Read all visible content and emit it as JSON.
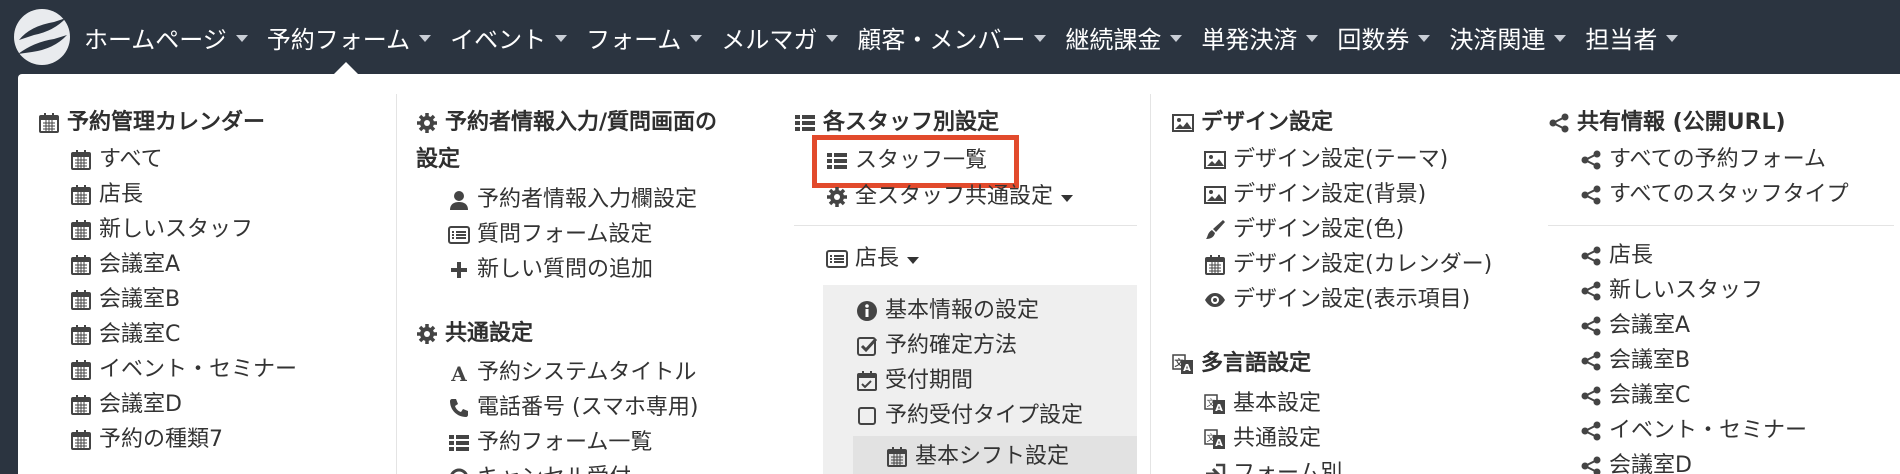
{
  "nav": {
    "items": [
      "ホームページ",
      "予約フォーム",
      "イベント",
      "フォーム",
      "メルマガ",
      "顧客・メンバー",
      "継続課金",
      "単発決済",
      "回数券",
      "決済関連",
      "担当者"
    ]
  },
  "col1": {
    "title": "予約管理カレンダー",
    "items": [
      "すべて",
      "店長",
      "新しいスタッフ",
      "会議室A",
      "会議室B",
      "会議室C",
      "イベント・セミナー",
      "会議室D",
      "予約の種類7"
    ]
  },
  "col2": {
    "title_line1": "予約者情報入力/質問画面の",
    "title_line2": "設定",
    "items": [
      "予約者情報入力欄設定",
      "質問フォーム設定",
      "新しい質問の追加"
    ],
    "common_title": "共通設定",
    "common_items": [
      "予約システムタイトル",
      "電話番号 (スマホ専用)",
      "予約フォーム一覧",
      "キャンセル受付"
    ]
  },
  "col3": {
    "title": "各スタッフ別設定",
    "staff_list": "スタッフ一覧",
    "all_staff": "全スタッフ共通設定",
    "manager": "店長",
    "sub_items": [
      "基本情報の設定",
      "予約確定方法",
      "受付期間",
      "予約受付タイプ設定"
    ],
    "shift": "基本シフト設定"
  },
  "col4": {
    "title": "デザイン設定",
    "items": [
      "デザイン設定(テーマ)",
      "デザイン設定(背景)",
      "デザイン設定(色)",
      "デザイン設定(カレンダー)",
      "デザイン設定(表示項目)"
    ],
    "lang_title": "多言語設定",
    "lang_items": [
      "基本設定",
      "共通設定",
      "フォーム別"
    ]
  },
  "col5": {
    "title": "共有情報 (公開URL)",
    "items_top": [
      "すべての予約フォーム",
      "すべてのスタッフタイプ"
    ],
    "items": [
      "店長",
      "新しいスタッフ",
      "会議室A",
      "会議室B",
      "会議室C",
      "イベント・セミナー",
      "会議室D"
    ]
  },
  "colors": {
    "navbar": "#2b3440",
    "highlight": "#e24a2c",
    "panel": "#ffffff"
  }
}
